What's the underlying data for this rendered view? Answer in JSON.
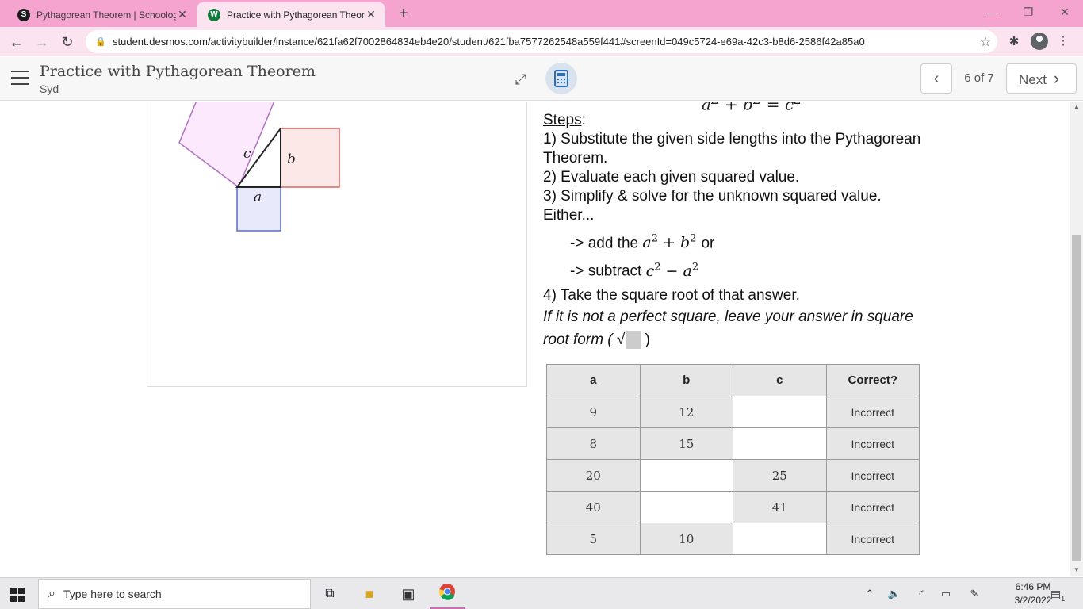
{
  "browser": {
    "tabs": [
      {
        "title": "Pythagorean Theorem | Schoology",
        "favicon_letter": "S",
        "favicon_color": "#1c1c1c"
      },
      {
        "title": "Practice with Pythagorean Theorem",
        "favicon_letter": "W",
        "favicon_color": "#127a3a"
      }
    ],
    "url": "student.desmos.com/activitybuilder/instance/621fa62f7002864834eb4e20/student/621fba7577262548a559f441#screenId=049c5724-e69a-42c3-b8d6-2586f42a85a0",
    "window_controls": {
      "minimize": "—",
      "restore": "❐",
      "close": "✕"
    }
  },
  "header": {
    "title": "Practice with Pythagorean Theorem",
    "student": "Syd",
    "page_indicator": "6 of 7",
    "next_label": "Next"
  },
  "diagram": {
    "labels": {
      "a": "a",
      "b": "b",
      "c": "c"
    },
    "colors": {
      "square_a": "#5a6ec8",
      "square_b": "#e06060",
      "square_c": "#b070c0"
    }
  },
  "steps": {
    "heading": "Steps",
    "heading_colon": ":",
    "step1": "1) Substitute the given side lengths into the Pythagorean Theorem.",
    "step2": "2) Evaluate each given squared value.",
    "step3": "3) Simplify & solve for the unknown squared value.",
    "either": "Either...",
    "option_add_prefix": "-> add the",
    "option_add_suffix": "or",
    "option_subtract_prefix": "-> subtract",
    "step4": "4) Take the square root of that answer.",
    "note": "If it is not a perfect square, leave your answer in square root form (",
    "note_end": ")"
  },
  "table": {
    "headers": [
      "a",
      "b",
      "c",
      "Correct?"
    ],
    "rows": [
      {
        "a": "9",
        "b": "12",
        "c": "",
        "status": "Incorrect"
      },
      {
        "a": "8",
        "b": "15",
        "c": "",
        "status": "Incorrect"
      },
      {
        "a": "20",
        "b": "",
        "c": "25",
        "status": "Incorrect"
      },
      {
        "a": "40",
        "b": "",
        "c": "41",
        "status": "Incorrect"
      },
      {
        "a": "5",
        "b": "10",
        "c": "",
        "status": "Incorrect"
      }
    ]
  },
  "taskbar": {
    "search_placeholder": "Type here to search",
    "time": "6:46 PM",
    "date": "3/2/2022",
    "notification_count": "1"
  }
}
